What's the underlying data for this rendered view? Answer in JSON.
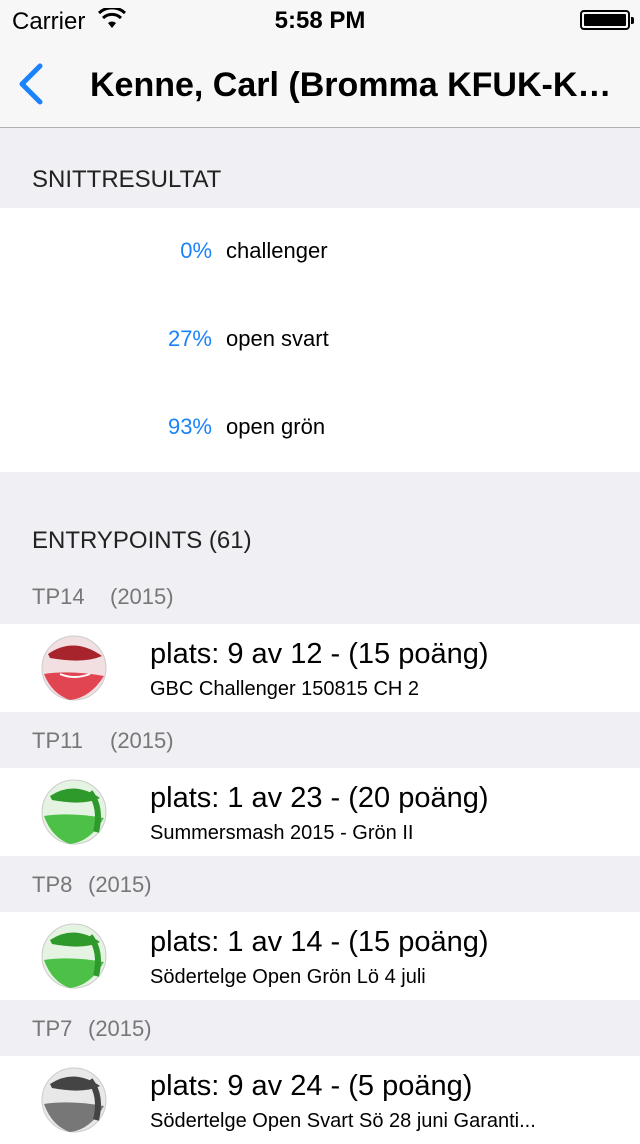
{
  "status_bar": {
    "carrier": "Carrier",
    "time": "5:58 PM"
  },
  "nav": {
    "title": "Kenne, Carl (Bromma KFUK-KF..."
  },
  "averages": {
    "header": "SNITTRESULTAT",
    "rows": [
      {
        "pct": "0%",
        "label": "challenger"
      },
      {
        "pct": "27%",
        "label": "open svart"
      },
      {
        "pct": "93%",
        "label": "open grön"
      }
    ]
  },
  "entrypoints": {
    "header": "ENTRYPOINTS (61)",
    "groups": [
      {
        "tp": "TP14",
        "year": "(2015)",
        "title": "plats: 9 av 12 - (15 poäng)",
        "subtitle": "GBC Challenger 150815 CH 2",
        "ball": "red"
      },
      {
        "tp": "TP11",
        "year": "(2015)",
        "title": "plats: 1 av 23 - (20 poäng)",
        "subtitle": "Summersmash 2015 - Grön II",
        "ball": "green"
      },
      {
        "tp": "TP8",
        "year": "(2015)",
        "title": "plats: 1 av 14 - (15 poäng)",
        "subtitle": "Södertelge Open Grön Lö 4 juli",
        "ball": "green"
      },
      {
        "tp": "TP7",
        "year": "(2015)",
        "title": "plats: 9 av 24 - (5 poäng)",
        "subtitle": "Södertelge Open Svart Sö 28 juni Garanti...",
        "ball": "gray"
      }
    ]
  },
  "colors": {
    "accent": "#1a82fb",
    "ball_red": "#c8313a",
    "ball_green": "#3aa935",
    "ball_gray": "#5a5a5a"
  }
}
